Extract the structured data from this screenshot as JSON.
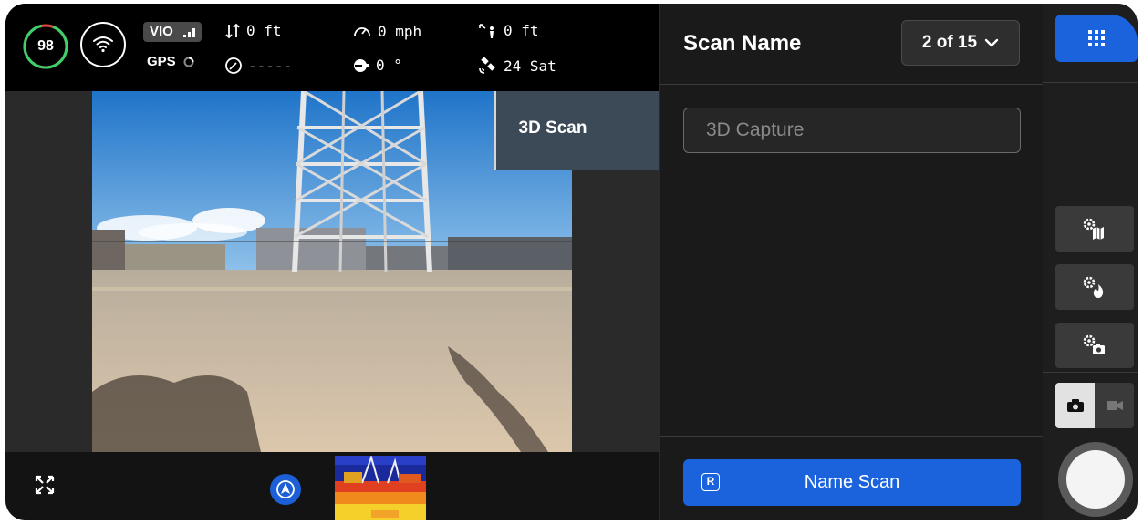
{
  "telemetry": {
    "battery": "98",
    "vio_label": "VIO",
    "gps_label": "GPS",
    "vertical_speed": "0 ft",
    "heading_readout": "-----",
    "speed": "0 mph",
    "gimbal_angle": "0 °",
    "altitude": "0 ft",
    "satellites": "24 Sat"
  },
  "camera": {
    "mode_label": "3D Scan"
  },
  "panel": {
    "title": "Scan Name",
    "counter": "2 of 15",
    "name_placeholder": "3D Capture",
    "name_scan_key": "R",
    "name_scan_label": "Name Scan"
  },
  "icons": {
    "battery": "battery-ring-icon",
    "wifi": "wifi-icon",
    "signal": "signal-bars-icon",
    "gps": "gps-status-icon",
    "vertical_speed": "up-down-arrows-icon",
    "heading": "compass-icon",
    "speed": "speedometer-icon",
    "gimbal": "gimbal-icon",
    "altitude": "altitude-person-icon",
    "satellite": "satellite-icon",
    "expand": "expand-icon",
    "navigation": "navigation-arrow-icon",
    "chevron": "chevron-down-icon",
    "apps": "grid-apps-icon",
    "map_settings": "map-gear-icon",
    "fire_settings": "fire-gear-icon",
    "camera_settings": "camera-gear-icon",
    "photo": "camera-icon",
    "video": "video-icon"
  },
  "colors": {
    "accent_blue": "#1b63dc",
    "battery_green": "#3ad16b",
    "battery_red": "#e0483e"
  },
  "mode": {
    "active": "photo"
  }
}
